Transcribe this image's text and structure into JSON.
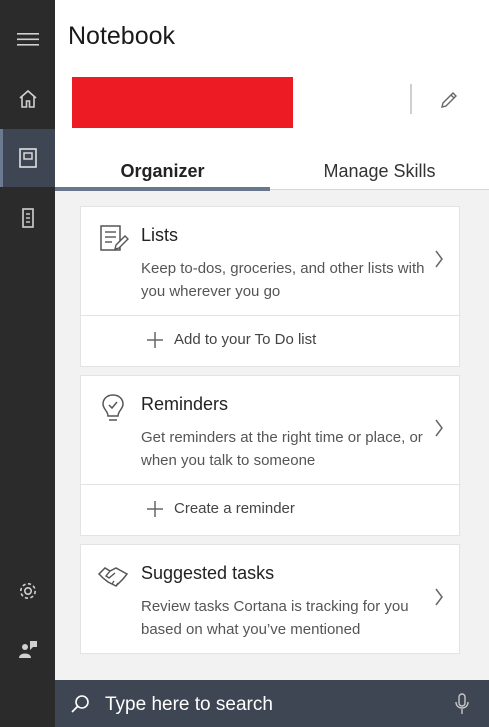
{
  "window": {
    "title": "Notebook"
  },
  "rail": {
    "items": [
      {
        "name": "menu",
        "icon": "hamburger-icon"
      },
      {
        "name": "home",
        "icon": "home-icon"
      },
      {
        "name": "notebook",
        "icon": "notebook-icon",
        "active": true
      },
      {
        "name": "devices",
        "icon": "device-icon"
      },
      {
        "name": "settings",
        "icon": "gear-icon"
      },
      {
        "name": "feedback",
        "icon": "feedback-icon"
      }
    ]
  },
  "profile": {
    "name_redacted": true,
    "redaction_color": "#ed1c24",
    "edit_icon": "pencil-icon"
  },
  "tabs": [
    {
      "label": "Organizer",
      "selected": true
    },
    {
      "label": "Manage Skills",
      "selected": false
    }
  ],
  "cards": [
    {
      "icon": "list-icon",
      "title": "Lists",
      "description": "Keep to-dos, groceries, and other lists with you wherever you go",
      "action": "Add to your To Do list"
    },
    {
      "icon": "lightbulb-icon",
      "title": "Reminders",
      "description": "Get reminders at the right time or place, or when you talk to someone",
      "action": "Create a reminder"
    },
    {
      "icon": "handshake-icon",
      "title": "Suggested tasks",
      "description": "Review tasks Cortana is tracking for you based on what you’ve mentioned"
    }
  ],
  "search": {
    "placeholder": "Type here to search",
    "icon": "search-icon",
    "mic_icon": "microphone-icon"
  },
  "colors": {
    "rail": "#2b2b2b",
    "accent": "#69778d",
    "searchbar": "#3f4653"
  }
}
